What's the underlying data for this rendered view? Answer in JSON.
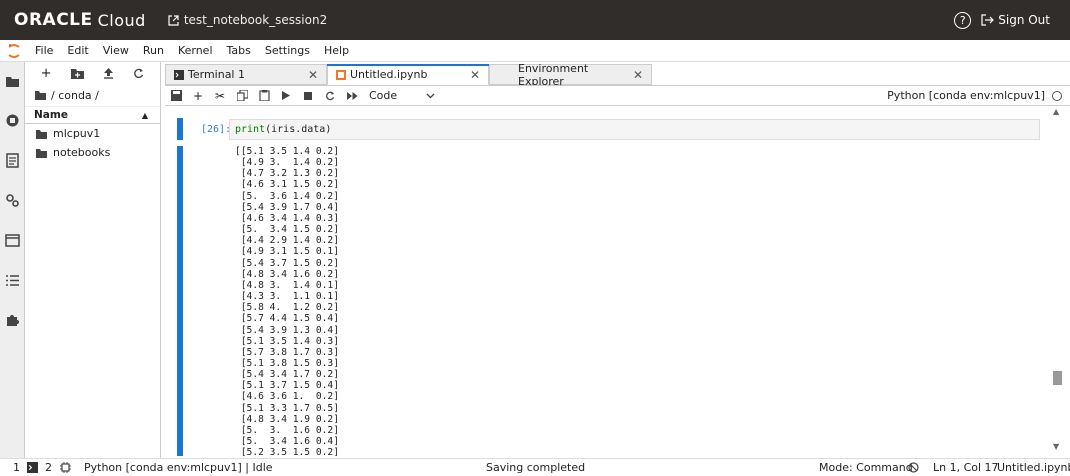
{
  "topbar": {
    "brand_bold": "ORACLE",
    "brand_light": "Cloud",
    "session": "test_notebook_session2",
    "help": "?",
    "signout": "Sign Out"
  },
  "menu": [
    "File",
    "Edit",
    "View",
    "Run",
    "Kernel",
    "Tabs",
    "Settings",
    "Help"
  ],
  "filebrowser": {
    "breadcrumb": "/ conda /",
    "header": "Name",
    "items": [
      "mlcpuv1",
      "notebooks"
    ]
  },
  "tabs": [
    {
      "label": "Terminal 1",
      "icon": "terminal-icon"
    },
    {
      "label": "Untitled.ipynb",
      "icon": "notebook-icon"
    },
    {
      "label": "Environment Explorer",
      "icon": ""
    }
  ],
  "toolbar": {
    "cell_type": "Code",
    "kernel": "Python [conda env:mlcpuv1]"
  },
  "cell": {
    "prompt": "[26]:",
    "code_fn": "print",
    "code_rest": "(iris.data)",
    "output_lines": [
      "[[5.1 3.5 1.4 0.2]",
      " [4.9 3.  1.4 0.2]",
      " [4.7 3.2 1.3 0.2]",
      " [4.6 3.1 1.5 0.2]",
      " [5.  3.6 1.4 0.2]",
      " [5.4 3.9 1.7 0.4]",
      " [4.6 3.4 1.4 0.3]",
      " [5.  3.4 1.5 0.2]",
      " [4.4 2.9 1.4 0.2]",
      " [4.9 3.1 1.5 0.1]",
      " [5.4 3.7 1.5 0.2]",
      " [4.8 3.4 1.6 0.2]",
      " [4.8 3.  1.4 0.1]",
      " [4.3 3.  1.1 0.1]",
      " [5.8 4.  1.2 0.2]",
      " [5.7 4.4 1.5 0.4]",
      " [5.4 3.9 1.3 0.4]",
      " [5.1 3.5 1.4 0.3]",
      " [5.7 3.8 1.7 0.3]",
      " [5.1 3.8 1.5 0.3]",
      " [5.4 3.4 1.7 0.2]",
      " [5.1 3.7 1.5 0.4]",
      " [4.6 3.6 1.  0.2]",
      " [5.1 3.3 1.7 0.5]",
      " [4.8 3.4 1.9 0.2]",
      " [5.  3.  1.6 0.2]",
      " [5.  3.4 1.6 0.4]",
      " [5.2 3.5 1.5 0.2]"
    ]
  },
  "status": {
    "num1": "1",
    "num2": "2",
    "kernel": "Python [conda env:mlcpuv1] | Idle",
    "saving": "Saving completed",
    "mode": "Mode: Command",
    "position": "Ln 1, Col 17",
    "file": "Untitled.ipynb"
  }
}
